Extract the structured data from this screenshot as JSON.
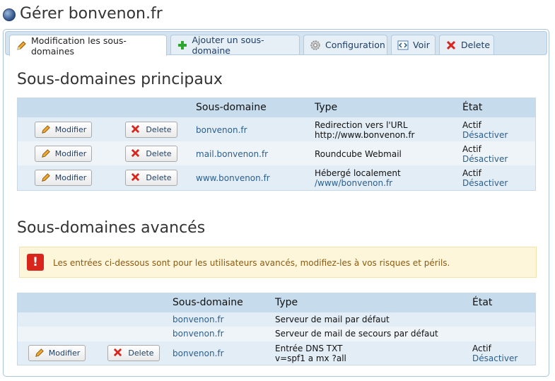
{
  "header": {
    "title": "Gérer bonvenon.fr",
    "icon": "globe-icon"
  },
  "tabs": [
    {
      "label": "Modification les sous-domaines",
      "icon": "pencil-icon",
      "active": true
    },
    {
      "label": "Ajouter un sous-domaine",
      "icon": "plus-icon",
      "active": false
    },
    {
      "label": "Configuration",
      "icon": "gear-icon",
      "active": false
    },
    {
      "label": "Voir",
      "icon": "code-icon",
      "active": false
    },
    {
      "label": "Delete",
      "icon": "x-icon",
      "active": false
    }
  ],
  "main_section": {
    "heading": "Sous-domaines principaux",
    "columns": {
      "subdomain": "Sous-domaine",
      "type": "Type",
      "state": "État"
    },
    "rows": [
      {
        "modify": "Modifier",
        "delete": "Delete",
        "subdomain": "bonvenon.fr",
        "type_line1": "Redirection vers l'URL",
        "type_line2": "http://www.bonvenon.fr",
        "state": "Actif",
        "action": "Désactiver"
      },
      {
        "modify": "Modifier",
        "delete": "Delete",
        "subdomain": "mail.bonvenon.fr",
        "type_line1": "Roundcube Webmail",
        "type_line2": "",
        "state": "Actif",
        "action": "Désactiver"
      },
      {
        "modify": "Modifier",
        "delete": "Delete",
        "subdomain": "www.bonvenon.fr",
        "type_line1": "Hébergé localement",
        "type_line2": "/www/bonvenon.fr",
        "state": "Actif",
        "action": "Désactiver"
      }
    ]
  },
  "advanced_section": {
    "heading": "Sous-domaines avancés",
    "warning": "Les entrées ci-dessous sont pour les utilisateurs avancés, modifiez-les à vos risques et périls.",
    "columns": {
      "subdomain": "Sous-domaine",
      "type": "Type",
      "state": "État"
    },
    "rows": [
      {
        "subdomain": "bonvenon.fr",
        "type_line1": "Serveur de mail par défaut"
      },
      {
        "subdomain": "bonvenon.fr",
        "type_line1": "Serveur de mail de secours par défaut"
      },
      {
        "modify": "Modifier",
        "delete": "Delete",
        "subdomain": "bonvenon.fr",
        "type_line1": "Entrée DNS TXT",
        "type_line2": "v=spf1 a mx ?all",
        "state": "Actif",
        "action": "Désactiver"
      }
    ]
  },
  "colors": {
    "accent": "#2b5f8e",
    "header_row": "#c6dbec",
    "warning_bg": "#fdf6db",
    "danger": "#d9261c"
  }
}
